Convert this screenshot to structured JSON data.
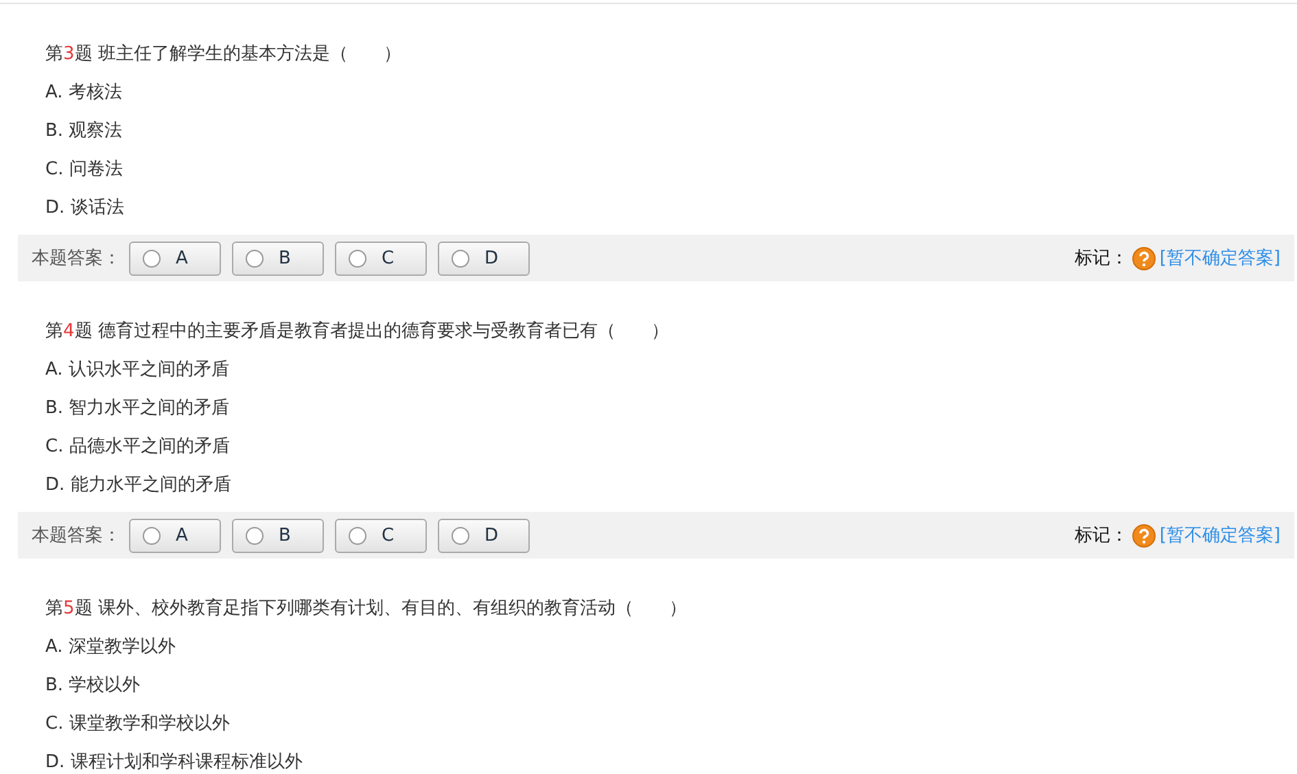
{
  "questions": [
    {
      "prefix": "第",
      "number": "3",
      "suffix": "题",
      "text": "班主任了解学生的基本方法是（　　）",
      "options": [
        "A. 考核法",
        "B. 观察法",
        "C. 问卷法",
        "D. 谈话法"
      ],
      "answer_bar": {
        "label": "本题答案：",
        "choices": [
          {
            "letter": "A",
            "selected": false
          },
          {
            "letter": "B",
            "selected": false
          },
          {
            "letter": "C",
            "selected": false
          },
          {
            "letter": "D",
            "selected": false
          }
        ],
        "mark_label": "标记：",
        "mark_link": "[暂不确定答案]"
      }
    },
    {
      "prefix": "第",
      "number": "4",
      "suffix": "题",
      "text": "德育过程中的主要矛盾是教育者提出的德育要求与受教育者已有（　　）",
      "options": [
        "A. 认识水平之间的矛盾",
        "B. 智力水平之间的矛盾",
        "C. 品德水平之间的矛盾",
        "D. 能力水平之间的矛盾"
      ],
      "answer_bar": {
        "label": "本题答案：",
        "choices": [
          {
            "letter": "A",
            "selected": false
          },
          {
            "letter": "B",
            "selected": false
          },
          {
            "letter": "C",
            "selected": false
          },
          {
            "letter": "D",
            "selected": false
          }
        ],
        "mark_label": "标记：",
        "mark_link": "[暂不确定答案]"
      }
    },
    {
      "prefix": "第",
      "number": "5",
      "suffix": "题",
      "text": "课外、校外教育足指下列哪类有计划、有目的、有组织的教育活动（　　）",
      "options": [
        "A. 深堂教学以外",
        "B. 学校以外",
        "C. 课堂教学和学校以外",
        "D. 课程计划和学科课程标准以外"
      ]
    }
  ]
}
